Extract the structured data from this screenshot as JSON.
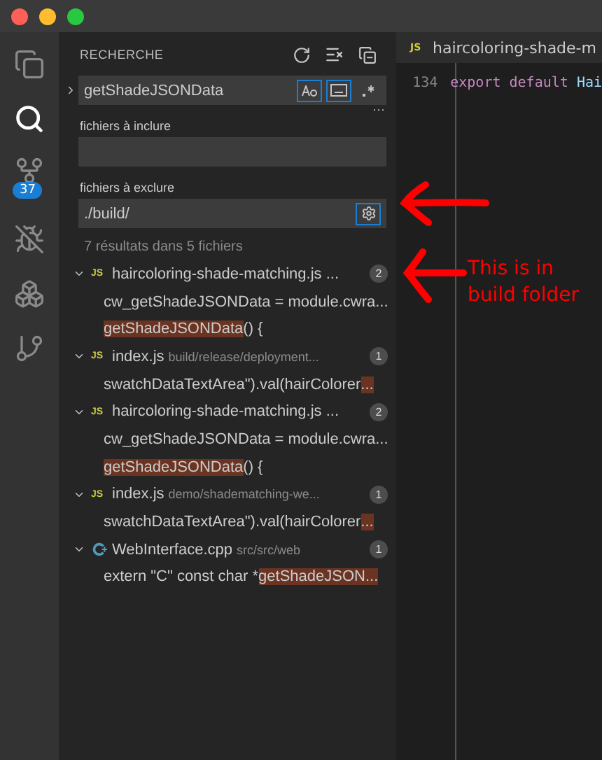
{
  "activity_bar": [
    {
      "kind": "files",
      "selected": false
    },
    {
      "kind": "search",
      "selected": true
    },
    {
      "kind": "scm",
      "selected": false,
      "badge": "37"
    },
    {
      "kind": "debug",
      "selected": false
    },
    {
      "kind": "extensions",
      "selected": false
    },
    {
      "kind": "git",
      "selected": false
    }
  ],
  "sidebar": {
    "title": "RECHERCHE",
    "search": {
      "value": "getShadeJSONData",
      "match_case": true,
      "whole_word": true,
      "regex": false
    },
    "more": "···",
    "include": {
      "label": "fichiers à inclure"
    },
    "exclude": {
      "label": "fichiers à exclure",
      "value": "./build/",
      "use_exclude_settings": true
    },
    "summary": "7 résultats dans 5 fichiers",
    "results": [
      {
        "kind": "js",
        "icon_text": "JS",
        "name": "haircoloring-shade-matching.js ...",
        "count": "2",
        "expanded": true,
        "matches": [
          [
            {
              "text": "cw_getShadeJSONData = module.cwra...",
              "highlighted": false
            }
          ],
          [
            {
              "text": "getShadeJSONData",
              "highlighted": true
            },
            {
              "text": "() {",
              "highlighted": false
            }
          ]
        ]
      },
      {
        "kind": "js",
        "icon_text": "JS",
        "name": "index.js",
        "path": "build/release/deployment...",
        "count": "1",
        "expanded": true,
        "matches": [
          [
            {
              "text": "swatchDataTextArea\").val(hairColorer",
              "highlighted": false
            },
            {
              "text": "...",
              "highlighted": true
            }
          ]
        ]
      },
      {
        "kind": "js",
        "icon_text": "JS",
        "name": "haircoloring-shade-matching.js ...",
        "count": "2",
        "expanded": true,
        "matches": [
          [
            {
              "text": "cw_getShadeJSONData = module.cwra...",
              "highlighted": false
            }
          ],
          [
            {
              "text": "getShadeJSONData",
              "highlighted": true
            },
            {
              "text": "() {",
              "highlighted": false
            }
          ]
        ]
      },
      {
        "kind": "js",
        "icon_text": "JS",
        "name": "index.js",
        "path": "demo/shadematching-we...",
        "count": "1",
        "expanded": true,
        "matches": [
          [
            {
              "text": "swatchDataTextArea\").val(hairColorer",
              "highlighted": false
            },
            {
              "text": "...",
              "highlighted": true
            }
          ]
        ]
      },
      {
        "kind": "cpp",
        "name": "WebInterface.cpp",
        "path": "src/src/web",
        "count": "1",
        "expanded": true,
        "matches": [
          [
            {
              "text": "extern \"C\" const char *",
              "highlighted": false
            },
            {
              "text": "getShadeJSON...",
              "highlighted": true
            }
          ]
        ]
      }
    ]
  },
  "editor": {
    "tab": {
      "kind": "js",
      "icon_text": "JS",
      "label": "haircoloring-shade-m"
    },
    "lines": [
      {
        "number": "134",
        "tokens": [
          {
            "text": "export default ",
            "kind": "keyword"
          },
          {
            "text": "Hai",
            "kind": "identifier"
          }
        ]
      }
    ]
  },
  "annotation": {
    "text": [
      "This is in",
      "build folder"
    ]
  }
}
